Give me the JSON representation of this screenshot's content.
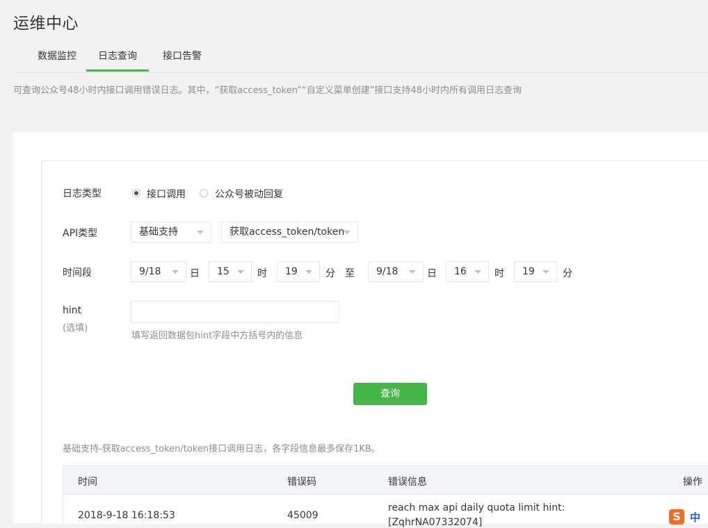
{
  "page_title": "运维中心",
  "tabs": [
    {
      "label": "数据监控",
      "active": false
    },
    {
      "label": "日志查询",
      "active": true
    },
    {
      "label": "接口告警",
      "active": false
    }
  ],
  "description": "可查询公众号48小时内接口调用错误日志。其中，“获取access_token”“自定义菜单创建”接口支持48小时内所有调用日志查询",
  "form": {
    "log_type_label": "日志类型",
    "log_type_options": [
      {
        "label": "接口调用",
        "checked": true
      },
      {
        "label": "公众号被动回复",
        "checked": false
      }
    ],
    "api_type_label": "API类型",
    "api_category": "基础支持",
    "api_name": "获取access_token/token",
    "time_range_label": "时间段",
    "start": {
      "date": "9/18",
      "hour": "15",
      "minute": "19"
    },
    "end": {
      "date": "9/18",
      "hour": "16",
      "minute": "19"
    },
    "unit_day": "日",
    "unit_hour": "时",
    "unit_minute": "分",
    "range_to": "至",
    "hint_label": "hint",
    "hint_optional": "(选填)",
    "hint_value": "",
    "hint_tip": "填写返回数据包hint字段中方括号内的信息",
    "query_button": "查询"
  },
  "results": {
    "caption": "基础支持-获取access_token/token接口调用日志，各字段信息最多保存1KB。",
    "columns": [
      "时间",
      "错误码",
      "错误信息",
      "操作"
    ],
    "rows": [
      {
        "time": "2018-9-18 16:18:53",
        "code": "45009",
        "message_line1": "reach max api daily quota limit hint:",
        "message_line2": "[ZqhrNA07332074]"
      }
    ]
  },
  "ime_badge": {
    "logo": "S",
    "mode": "中"
  },
  "colors": {
    "accent": "#44b549",
    "border": "#e7e7eb",
    "muted": "#8d8d8d",
    "text": "#353535"
  }
}
